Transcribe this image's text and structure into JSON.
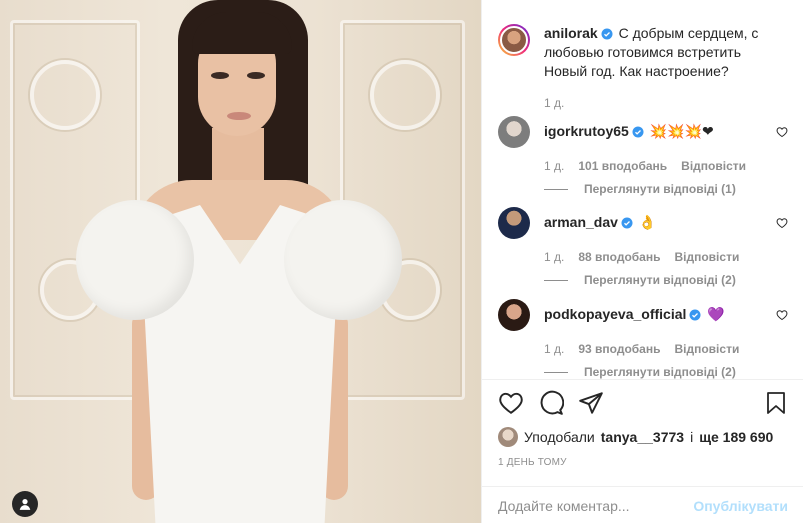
{
  "post": {
    "author": "anilorak",
    "caption": "С добрым сердцем, с любовью готовимся встретить Новый год. Как настроение?",
    "caption_time": "1 д.",
    "author_avatar_colors": [
      "#8a5a44",
      "#d8a27f"
    ]
  },
  "comments": [
    {
      "username": "igorkrutoy65",
      "text": "💥💥💥❤",
      "time": "1 д.",
      "likes": "101 вподобань",
      "reply": "Відповісти",
      "view_replies": "Переглянути відповіді (1)",
      "avatar_colors": [
        "#c9c9c9",
        "#7d7d7d"
      ]
    },
    {
      "username": "arman_dav",
      "text": "👌",
      "time": "1 д.",
      "likes": "88 вподобань",
      "reply": "Відповісти",
      "view_replies": "Переглянути відповіді (2)",
      "avatar_colors": [
        "#1d2a4a",
        "#c49a7a"
      ]
    },
    {
      "username": "podkopayeva_official",
      "text": "💜",
      "time": "1 д.",
      "likes": "93 вподобань",
      "reply": "Відповісти",
      "view_replies": "Переглянути відповіді (2)",
      "avatar_colors": [
        "#2a1a14",
        "#d9a58a"
      ]
    }
  ],
  "likes": {
    "prefix": "Уподобали",
    "user": "tanya__3773",
    "joiner": "і",
    "rest": "ще 189 690"
  },
  "timestamp": "1 ДЕНЬ ТОМУ",
  "add_comment": {
    "placeholder": "Додайте коментар...",
    "publish_label": "Опублікувати"
  },
  "icons": {
    "like": "heart-icon",
    "comment": "comment-icon",
    "share": "share-icon",
    "save": "bookmark-icon",
    "verified": "verified-badge-icon"
  },
  "colors": {
    "verified": "#3897f0",
    "muted": "#8e8e8e",
    "publish_disabled": "#b2dffc"
  }
}
